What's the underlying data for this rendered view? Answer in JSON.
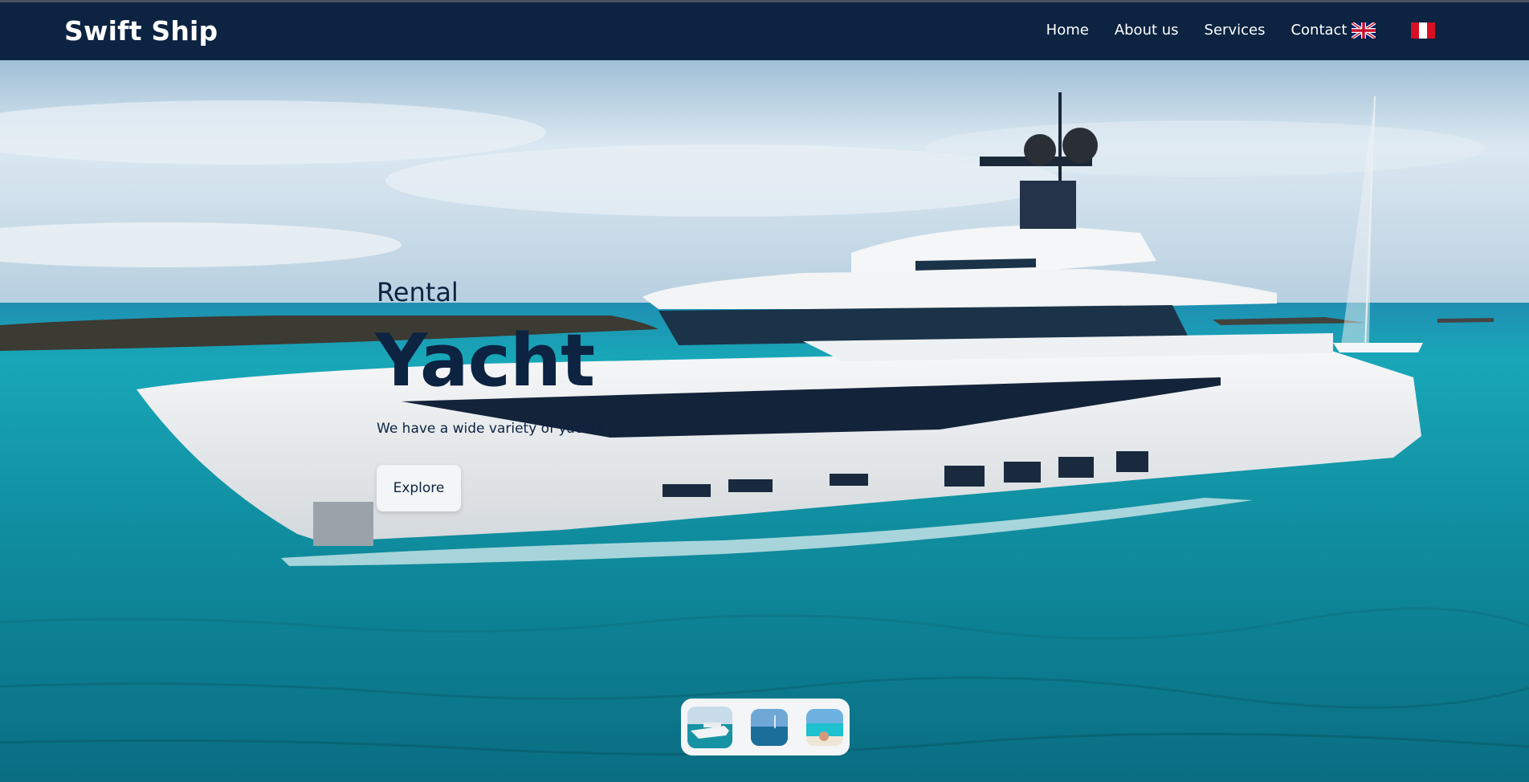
{
  "brand": "Swift Ship",
  "nav": {
    "links": [
      "Home",
      "About us",
      "Services",
      "Contact us"
    ],
    "languages": [
      {
        "name": "uk-flag-icon"
      },
      {
        "name": "peru-flag-icon"
      }
    ]
  },
  "hero": {
    "subtitle": "Rental",
    "title": "Yacht",
    "tagline": "We have a wide variety of yachts.",
    "button_label": "Explore"
  },
  "carousel": {
    "thumbnails": [
      "yacht-thumbnail",
      "sea-thumbnail",
      "beach-thumbnail"
    ]
  },
  "colors": {
    "navbar": "#0c2341",
    "text_dark": "#0c2341",
    "sea": "#138d9c",
    "sky": "#cfe0ec"
  }
}
